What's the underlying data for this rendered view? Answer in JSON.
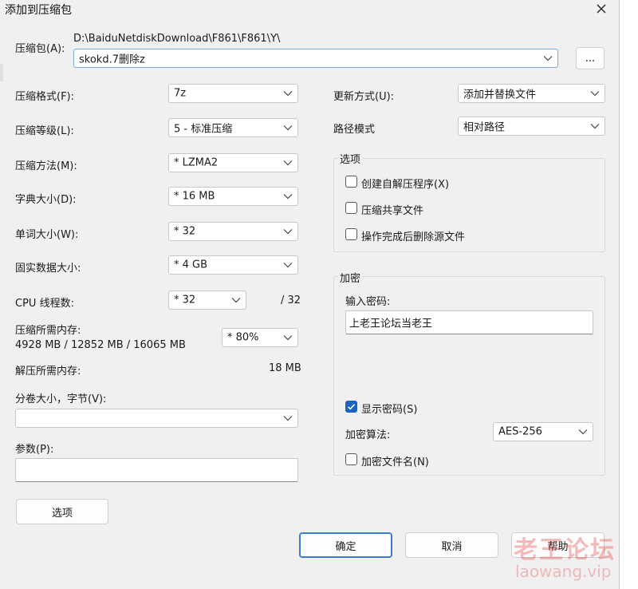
{
  "dialog": {
    "title": "添加到压缩包"
  },
  "archive": {
    "label": "压缩包(A):",
    "path": "D:\\BaiduNetdiskDownload\\F861\\F861\\Y\\",
    "name": "skokd.7删除z",
    "browse_label": "..."
  },
  "left": {
    "format": {
      "label": "压缩格式(F):",
      "value": "7z"
    },
    "level": {
      "label": "压缩等级(L):",
      "value": "5 - 标准压缩"
    },
    "method": {
      "label": "压缩方法(M):",
      "value": "*  LZMA2"
    },
    "dict": {
      "label": "字典大小(D):",
      "value": "*  16 MB"
    },
    "word": {
      "label": "单词大小(W):",
      "value": "*  32"
    },
    "solid": {
      "label": "固实数据大小:",
      "value": "*  4 GB"
    },
    "cpu": {
      "label": "CPU 线程数:",
      "value": "*  32",
      "total": "/ 32"
    },
    "mem_compress": {
      "label": "压缩所需内存:",
      "detail": "4928 MB / 12852 MB / 16065 MB",
      "value": "*  80%"
    },
    "mem_decompress": {
      "label": "解压所需内存:",
      "value": "18 MB"
    },
    "volume": {
      "label": "分卷大小，字节(V):",
      "value": ""
    },
    "params": {
      "label": "参数(P):",
      "value": ""
    },
    "options_button": "选项"
  },
  "right": {
    "update": {
      "label": "更新方式(U):",
      "value": "添加并替换文件"
    },
    "path_mode": {
      "label": "路径模式",
      "value": "相对路径"
    },
    "options_group": {
      "title": "选项",
      "sfx": {
        "label": "创建自解压程序(X)",
        "checked": false
      },
      "shared": {
        "label": "压缩共享文件",
        "checked": false
      },
      "delete_after": {
        "label": "操作完成后删除源文件",
        "checked": false
      }
    },
    "encrypt_group": {
      "title": "加密",
      "password_label": "输入密码:",
      "password_value": "上老王论坛当老王",
      "show_password": {
        "label": "显示密码(S)",
        "checked": true
      },
      "algo_label": "加密算法:",
      "algo_value": "AES-256",
      "encrypt_names": {
        "label": "加密文件名(N)",
        "checked": false
      }
    }
  },
  "buttons": {
    "ok": "确定",
    "cancel": "取消",
    "help": "帮助"
  },
  "watermark": {
    "cn": "老王论坛",
    "en": "laowang.vip"
  },
  "colors": {
    "accent": "#1a63c2",
    "dialog_bg": "#f0f0f0"
  }
}
